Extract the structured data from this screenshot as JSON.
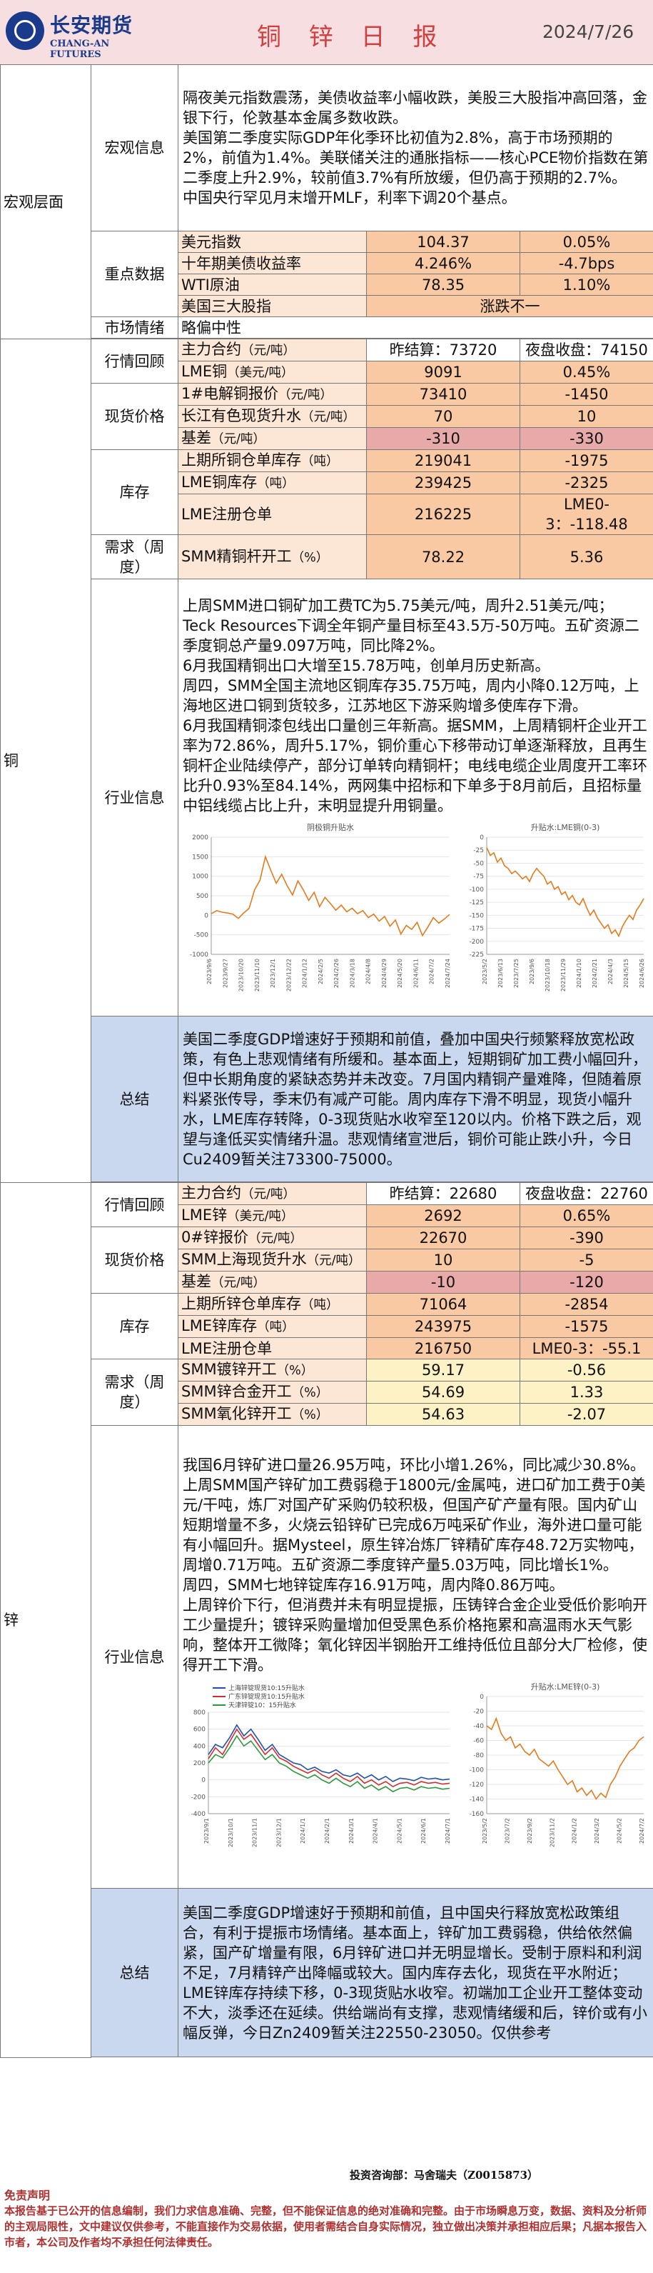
{
  "header": {
    "logo_cn": "长安期货",
    "logo_en": "CHANG-AN FUTURES",
    "title": "铜 锌 日 报",
    "date": "2024/7/26"
  },
  "macro": {
    "section": "宏观层面",
    "info_label": "宏观信息",
    "info_text": [
      "隔夜美元指数震荡，美债收益率小幅收跌，美股三大股指冲高回落，金银下行，伦敦基本金属多数收跌。",
      "美国第二季度实际GDP年化季环比初值为2.8%，高于市场预期的2%，前值为1.4%。美联储关注的通胀指标——核心PCE物价指数在第二季度上升2.9%，较前值3.7%有所放缓，但仍高于预期的2.7%。",
      "中国央行罕见月末增开MLF，利率下调20个基点。"
    ],
    "key_label": "重点数据",
    "rows": [
      {
        "name": "美元指数",
        "v1": "104.37",
        "v2": "0.05%"
      },
      {
        "name": "十年期美债收益率",
        "v1": "4.246%",
        "v2": "-4.7bps"
      },
      {
        "name": "WTI原油",
        "v1": "78.35",
        "v2": "1.10%"
      },
      {
        "name": "美国三大股指",
        "v1": "涨跌不一",
        "v2": ""
      }
    ],
    "sentiment_label": "市场情绪",
    "sentiment_value": "略偏中性"
  },
  "copper": {
    "section": "铜",
    "market_label": "行情回顾",
    "main_contract": {
      "name": "主力合约",
      "unit": "（元/吨）",
      "v1": "昨结算：73720",
      "v2": "夜盘收盘：74150"
    },
    "lme": {
      "name": "LME铜",
      "unit": "（美元/吨）",
      "v1": "9091",
      "v2": "0.45%"
    },
    "spot_label": "现货价格",
    "spot_rows": [
      {
        "name": "1#电解铜报价",
        "unit": "（元/吨）",
        "v1": "73410",
        "v2": "-1450"
      },
      {
        "name": "长江有色现货升水",
        "unit": "（元/吨）",
        "v1": "70",
        "v2": "10"
      },
      {
        "name": "基差",
        "unit": "（元/吨）",
        "v1": "-310",
        "v2": "-330"
      }
    ],
    "inventory_label": "库存",
    "inventory_rows": [
      {
        "name": "上期所铜仓单库存",
        "unit": "（吨）",
        "v1": "219041",
        "v2": "-1975"
      },
      {
        "name": "LME铜库存",
        "unit": "（吨）",
        "v1": "239425",
        "v2": "-2325"
      },
      {
        "name": "LME注册仓单",
        "unit": "",
        "v1": "216225",
        "v2": "LME0-3：-118.48"
      }
    ],
    "demand_label": "需求（周度）",
    "demand_rows": [
      {
        "name": "SMM精铜杆开工",
        "unit": "（%）",
        "v1": "78.22",
        "v2": "5.36"
      }
    ],
    "industry_label": "行业信息",
    "industry_text": [
      "上周SMM进口铜矿加工费TC为5.75美元/吨，周升2.51美元/吨；",
      "Teck Resources下调全年铜产量目标至43.5万-50万吨。五矿资源二季度铜总产量9.097万吨，同比降2%。",
      "6月我国精铜出口大增至15.78万吨，创单月历史新高。",
      "周四，SMM全国主流地区铜库存35.75万吨，周内小降0.12万吨，上海地区进口铜到货较多，江苏地区下游采购增多使库存下滑。",
      "6月我国精铜漆包线出口量创三年新高。据SMM，上周精铜杆企业开工率为72.86%，周升5.17%，铜价重心下移带动订单逐渐释放，且再生铜杆企业陆续停产，部分订单转向精铜杆；电线电缆企业周度开工率环比升0.93%至84.14%，两网集中招标和下单多于8月前后，且招标量中铝线缆占比上升，末明显提升用铜量。"
    ],
    "summary_label": "总结",
    "summary_text": "美国二季度GDP增速好于预期和前值，叠加中国央行频繁释放宽松政策，有色上悲观情绪有所缓和。基本面上，短期铜矿加工费小幅回升，但中长期角度的紧缺态势并未改变。7月国内精铜产量难降，但随着原料紧张传导，季末仍有减产可能。周内库存下滑不明显，现货小幅升水，LME库存转降，0-3现货贴水收窄至120以内。价格下跌之后，观望与逢低买实情绪升温。悲观情绪宣泄后，铜价可能止跌小升，今日Cu2409暂关注73300-75000。",
    "chart1": {
      "title": "阴极铜升贴水",
      "type": "line",
      "yticks": [
        "2000",
        "1500",
        "1000",
        "500",
        "0",
        "-500",
        "-1000"
      ],
      "ylim": [
        -1000,
        2000
      ],
      "values": [
        40,
        120,
        80,
        60,
        30,
        -80,
        60,
        180,
        650,
        900,
        1500,
        1150,
        820,
        1050,
        760,
        520,
        880,
        650,
        380,
        590,
        220,
        460,
        300,
        130,
        260,
        90,
        180,
        40,
        120,
        -60,
        30,
        -150,
        -30,
        -280,
        -120,
        -480,
        -260,
        -360,
        -180,
        -520,
        -300,
        -60,
        -200,
        -100,
        20
      ],
      "xticks": [
        "2023/9/6",
        "2023/9/27",
        "2023/10/20",
        "2023/11/10",
        "2023/12/1",
        "2023/12/22",
        "2024/1/12",
        "2024/2/5",
        "2024/2/26",
        "2024/3/18",
        "2024/4/8",
        "2024/4/29",
        "2024/5/20",
        "2024/6/11",
        "2024/7/2",
        "2024/7/24"
      ]
    },
    "chart2": {
      "title": "升贴水:LME铜(0-3)",
      "type": "line",
      "yticks": [
        "0",
        "-25",
        "-50",
        "-75",
        "-100",
        "-125",
        "-150",
        "-175",
        "-200",
        "-225"
      ],
      "ylim": [
        -225,
        0
      ],
      "values": [
        -20,
        -35,
        -30,
        -48,
        -40,
        -55,
        -60,
        -70,
        -65,
        -72,
        -80,
        -75,
        -85,
        -70,
        -60,
        -68,
        -75,
        -90,
        -85,
        -100,
        -95,
        -110,
        -105,
        -120,
        -112,
        -125,
        -130,
        -118,
        -135,
        -150,
        -140,
        -155,
        -165,
        -175,
        -168,
        -185,
        -178,
        -190,
        -172,
        -160,
        -150,
        -158,
        -140,
        -130,
        -118
      ],
      "xticks": [
        "2023/5/2",
        "2023/6/13",
        "2023/7/25",
        "2023/9/6",
        "2023/10/18",
        "2023/11/29",
        "2024/1/10",
        "2024/2/21",
        "2024/4/3",
        "2024/5/15",
        "2024/6/26"
      ]
    }
  },
  "zinc": {
    "section": "锌",
    "market_label": "行情回顾",
    "main_contract": {
      "name": "主力合约",
      "unit": "（元/吨）",
      "v1": "昨结算：22680",
      "v2": "夜盘收盘：22760"
    },
    "lme": {
      "name": "LME锌",
      "unit": "（美元/吨）",
      "v1": "2692",
      "v2": "0.65%"
    },
    "spot_label": "现货价格",
    "spot_rows": [
      {
        "name": "0#锌报价",
        "unit": "（元/吨）",
        "v1": "22670",
        "v2": "-390"
      },
      {
        "name": "SMM上海现货升水",
        "unit": "（元/吨）",
        "v1": "10",
        "v2": "-5"
      },
      {
        "name": "基差",
        "unit": "（元/吨）",
        "v1": "-10",
        "v2": "-120"
      }
    ],
    "inventory_label": "库存",
    "inventory_rows": [
      {
        "name": "上期所锌仓单库存",
        "unit": "（吨）",
        "v1": "71064",
        "v2": "-2854"
      },
      {
        "name": "LME锌库存",
        "unit": "（吨）",
        "v1": "243975",
        "v2": "-1575"
      },
      {
        "name": "LME注册仓单",
        "unit": "",
        "v1": "216750",
        "v2": "LME0-3：-55.1"
      }
    ],
    "demand_label": "需求（周度）",
    "demand_rows": [
      {
        "name": "SMM镀锌开工",
        "unit": "（%）",
        "v1": "59.17",
        "v2": "-0.56"
      },
      {
        "name": "SMM锌合金开工",
        "unit": "（%）",
        "v1": "54.69",
        "v2": "1.33"
      },
      {
        "name": "SMM氧化锌开工",
        "unit": "（%）",
        "v1": "54.63",
        "v2": "-2.07"
      }
    ],
    "industry_label": "行业信息",
    "industry_text": [
      "我国6月锌矿进口量26.95万吨，环比小增1.26%，同比减少30.8%。",
      "上周SMM国产锌矿加工费弱稳于1800元/金属吨，进口矿加工费于0美元/干吨，炼厂对国产矿采购仍较积极，但国产矿产量有限。国内矿山短期增量不多，火烧云铅锌矿已完成6万吨采矿作业，海外进口量可能有小幅回升。据Mysteel，原生锌冶炼厂锌精矿库存48.72万实物吨，周增0.71万吨。五矿资源二季度锌产量5.03万吨，同比增长1%。",
      "周四，SMM七地锌锭库存16.91万吨，周内降0.86万吨。",
      "上周锌价下行，但消费并未有明显提振，压铸锌合金企业受低价影响开工少量提升；镀锌采购量增加但受黑色系价格拖累和高温雨水天气影响，整体开工微降；氧化锌因半钢胎开工维持低位且部分大厂检修，使得开工下滑。"
    ],
    "summary_label": "总结",
    "summary_text": "美国二季度GDP增速好于预期和前值，且中国央行释放宽松政策组合，有利于提振市场情绪。基本面上，锌矿加工费弱稳，供给依然偏紧，国产矿增量有限，6月锌矿进口并无明显增长。受制于原料和利润不足，7月精锌产出降幅或较大。国内库存去化，现货在平水附近；LME锌库存持续下移，0-3现货贴水收窄。初端加工企业开工整体变动不大，淡季还在延续。供给端尚有支撑，悲观情绪缓和后，锌价或有小幅反弹，今日Zn2409暂关注22550-23050。仅供参考",
    "chart1": {
      "title": "",
      "type": "line",
      "legend": [
        "上海锌锭现货10:15升贴水",
        "广东锌锭现货10:15升贴水",
        "天津锌锭10：15升贴水"
      ],
      "colors": [
        "#1f4fb5",
        "#d92b2b",
        "#2a9a3a"
      ],
      "yticks": [
        "800",
        "600",
        "400",
        "200",
        "0",
        "-200",
        "-400"
      ],
      "ylim": [
        -400,
        800
      ],
      "series": [
        {
          "values": [
            300,
            420,
            380,
            500,
            650,
            520,
            600,
            480,
            350,
            420,
            300,
            250,
            200,
            180,
            120,
            150,
            100,
            80,
            120,
            60,
            40,
            80,
            20,
            60,
            0,
            40,
            -20,
            20,
            10,
            -10,
            30,
            10,
            20,
            0,
            10
          ]
        },
        {
          "values": [
            250,
            380,
            300,
            450,
            600,
            480,
            540,
            420,
            300,
            380,
            260,
            220,
            160,
            120,
            80,
            120,
            60,
            20,
            80,
            20,
            -20,
            40,
            -40,
            0,
            -60,
            -20,
            -80,
            -40,
            -30,
            -60,
            -20,
            -40,
            -30,
            -50,
            -40
          ]
        },
        {
          "values": [
            200,
            300,
            260,
            380,
            520,
            400,
            460,
            350,
            240,
            300,
            200,
            160,
            100,
            60,
            20,
            60,
            0,
            -40,
            20,
            -40,
            -80,
            -20,
            -100,
            -60,
            -120,
            -80,
            -140,
            -100,
            -90,
            -120,
            -80,
            -100,
            -90,
            -110,
            -100
          ]
        }
      ],
      "xticks": [
        "2023/9/1",
        "2023/10/1",
        "2023/11/1",
        "2023/12/1",
        "2024/1/1",
        "2024/2/1",
        "2024/3/1",
        "2024/4/1",
        "2024/5/1",
        "2024/6/1",
        "2024/7/1"
      ]
    },
    "chart2": {
      "title": "升贴水:LME锌(0-3)",
      "type": "line",
      "yticks": [
        "0",
        "-20",
        "-40",
        "-60",
        "-80",
        "-100",
        "-120",
        "-140",
        "-160"
      ],
      "ylim": [
        -160,
        0
      ],
      "values": [
        -40,
        -45,
        -30,
        -50,
        -60,
        -55,
        -70,
        -65,
        -75,
        -80,
        -72,
        -85,
        -90,
        -95,
        -88,
        -100,
        -110,
        -120,
        -115,
        -130,
        -125,
        -135,
        -128,
        -140,
        -132,
        -138,
        -120,
        -110,
        -95,
        -85,
        -75,
        -70,
        -60,
        -55
      ],
      "xticks": [
        "2023/5/2",
        "2023/7/2",
        "2023/9/2",
        "2023/11/2",
        "2024/1/2",
        "2024/3/2",
        "2024/5/2",
        "2024/7/2"
      ]
    }
  },
  "footer": {
    "contact": "投资咨询部：马舍瑞夫（Z0015873）",
    "disclaimer_title": "免责声明",
    "disclaimer_text": "本报告基于已公开的信息编制，我们力求信息准确、完整，但不能保证信息的绝对准确和完整。由于市场瞬息万变，数据、资料及分析师的主观局限性，文中建议仅供参考，不能直接作为交易依据，使用者需结合自身实际情况，独立做出决策并承担相应后果；凡据本报告入市者，本公司及作者均不承担任何法律责任。"
  }
}
